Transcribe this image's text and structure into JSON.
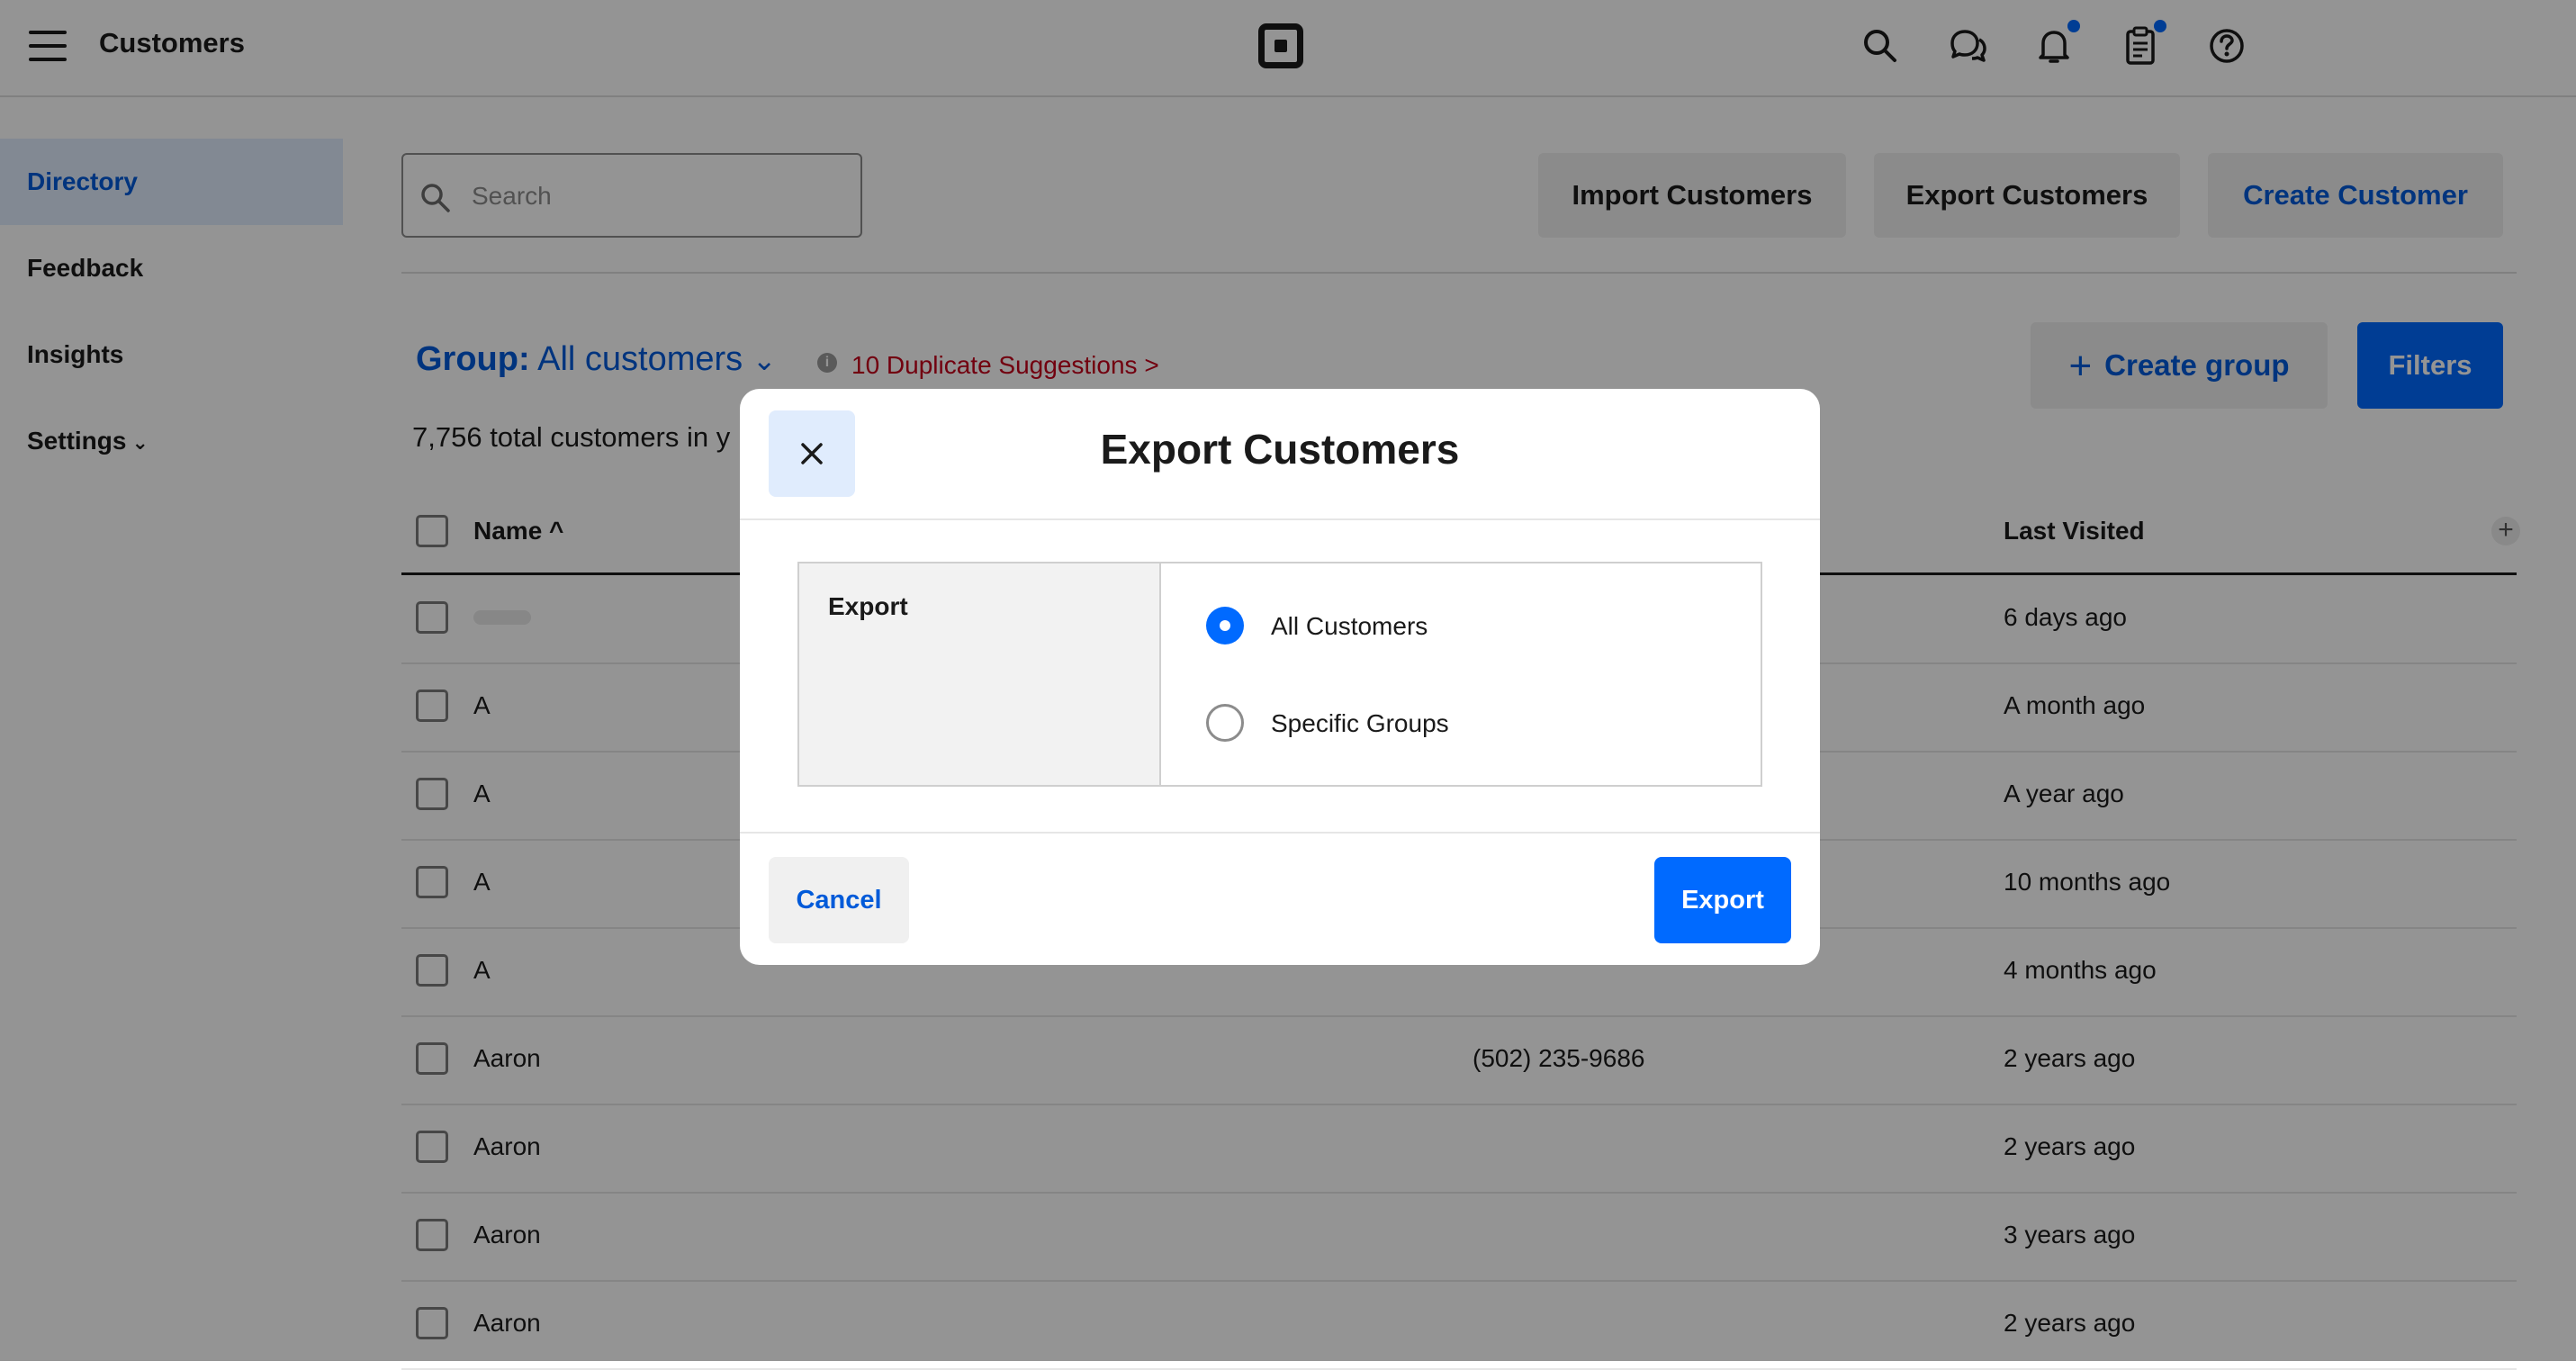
{
  "app": {
    "title": "Customers"
  },
  "topbar": {
    "icons": [
      "search-icon",
      "messages-icon",
      "notifications-icon",
      "clipboard-icon",
      "help-icon"
    ]
  },
  "sidebar": {
    "items": [
      {
        "label": "Directory",
        "active": true
      },
      {
        "label": "Feedback"
      },
      {
        "label": "Insights"
      },
      {
        "label": "Settings",
        "chevron": "⌄"
      }
    ]
  },
  "toolbar": {
    "search_placeholder": "Search",
    "import_label": "Import Customers",
    "export_label": "Export Customers",
    "create_label": "Create Customer"
  },
  "group": {
    "prefix": "Group:",
    "value": "All customers",
    "chevron": "⌄",
    "info": "i",
    "duplicates": "10 Duplicate Suggestions >",
    "total_text": "7,756 total customers in y",
    "create_group_label": "Create group",
    "filters_label": "Filters"
  },
  "table": {
    "columns": {
      "name": "Name ^",
      "last_visited": "Last Visited"
    },
    "add_column": "+",
    "rows": [
      {
        "name": "",
        "phone": "",
        "last_visited": "6 days ago"
      },
      {
        "name": "A",
        "phone": "",
        "last_visited": "A month ago"
      },
      {
        "name": "A",
        "phone": "",
        "last_visited": "A year ago"
      },
      {
        "name": "A",
        "phone": "",
        "last_visited": "10 months ago"
      },
      {
        "name": "A",
        "phone": "",
        "last_visited": "4 months ago"
      },
      {
        "name": "Aaron",
        "phone": "(502) 235-9686",
        "last_visited": "2 years ago"
      },
      {
        "name": "Aaron",
        "phone": "",
        "last_visited": "2 years ago"
      },
      {
        "name": "Aaron",
        "phone": "",
        "last_visited": "3 years ago"
      },
      {
        "name": "Aaron",
        "phone": "",
        "last_visited": "2 years ago"
      }
    ]
  },
  "modal": {
    "title": "Export Customers",
    "section_label": "Export",
    "options": [
      {
        "label": "All Customers",
        "selected": true
      },
      {
        "label": "Specific Groups",
        "selected": false
      }
    ],
    "cancel_label": "Cancel",
    "export_label": "Export"
  },
  "colors": {
    "accent": "#006aff",
    "link": "#005ad9",
    "danger": "#c4001a"
  }
}
